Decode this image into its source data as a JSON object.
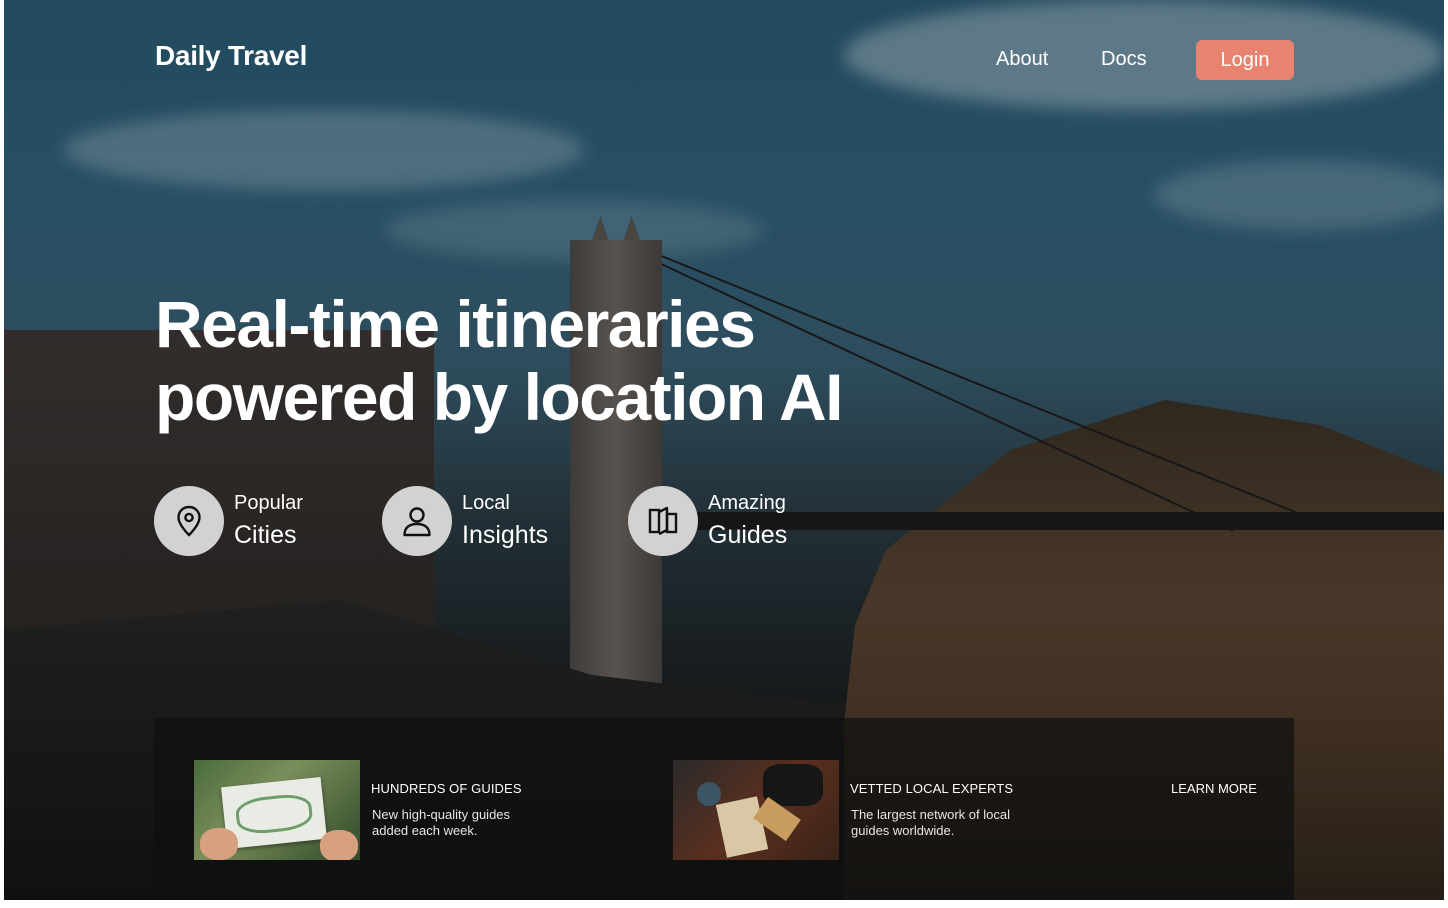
{
  "header": {
    "logo": "Daily Travel",
    "nav": {
      "about": "About",
      "docs": "Docs"
    },
    "login_label": "Login"
  },
  "hero": {
    "title_line1": "Real-time itineraries",
    "title_line2": "powered by location AI"
  },
  "features": [
    {
      "small": "Popular",
      "big": "Cities",
      "icon": "map-pin-icon"
    },
    {
      "small": "Local",
      "big": "Insights",
      "icon": "user-icon"
    },
    {
      "small": "Amazing",
      "big": "Guides",
      "icon": "book-icon"
    }
  ],
  "cards": [
    {
      "title": "HUNDREDS OF GUIDES",
      "description": "New high-quality guides added each week."
    },
    {
      "title": "VETTED LOCAL EXPERTS",
      "description": "The largest network of local guides worldwide."
    }
  ],
  "learn_more": "LEARN MORE",
  "colors": {
    "accent": "#e8836f",
    "icon_circle": "#d2d2d2",
    "panel": "#0f0f0f"
  }
}
